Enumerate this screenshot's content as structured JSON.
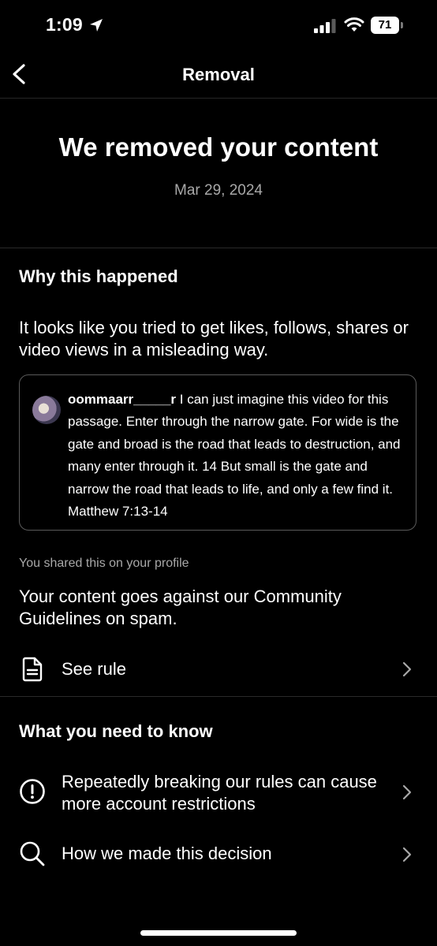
{
  "status_bar": {
    "time": "1:09",
    "battery": "71",
    "icons": [
      "location-arrow-icon",
      "signal-bars-icon",
      "wifi-icon",
      "battery-icon"
    ]
  },
  "nav": {
    "title": "Removal",
    "back_icon": "chevron-left-icon"
  },
  "hero": {
    "title": "We removed your content",
    "date": "Mar 29, 2024"
  },
  "why": {
    "heading": "Why this happened",
    "text": "It looks like you tried to get likes, follows, shares or video views in a misleading way.",
    "comment": {
      "username": "oommaarr_____r",
      "text": " I can just imagine this video for this passage. Enter through the narrow gate. For wide is the gate and broad is the road that leads to destruction, and many enter through it. 14 But small is the gate and narrow the road that leads to life, and only a few find it. Matthew 7:13-14"
    },
    "shared_note": "You shared this on your profile",
    "guidelines": "Your content goes against our Community Guidelines on spam.",
    "see_rule": {
      "label": "See rule",
      "icon": "document-icon"
    }
  },
  "know": {
    "heading": "What you need to know",
    "items": [
      {
        "label": "Repeatedly breaking our rules can cause more account restrictions",
        "icon": "alert-circle-icon"
      },
      {
        "label": "How we made this decision",
        "icon": "search-icon"
      }
    ]
  },
  "colors": {
    "background": "#000000",
    "text": "#ffffff",
    "secondary_text": "#a8a8a8",
    "divider": "#2a2a2a",
    "card_border": "#5a5a5a"
  }
}
